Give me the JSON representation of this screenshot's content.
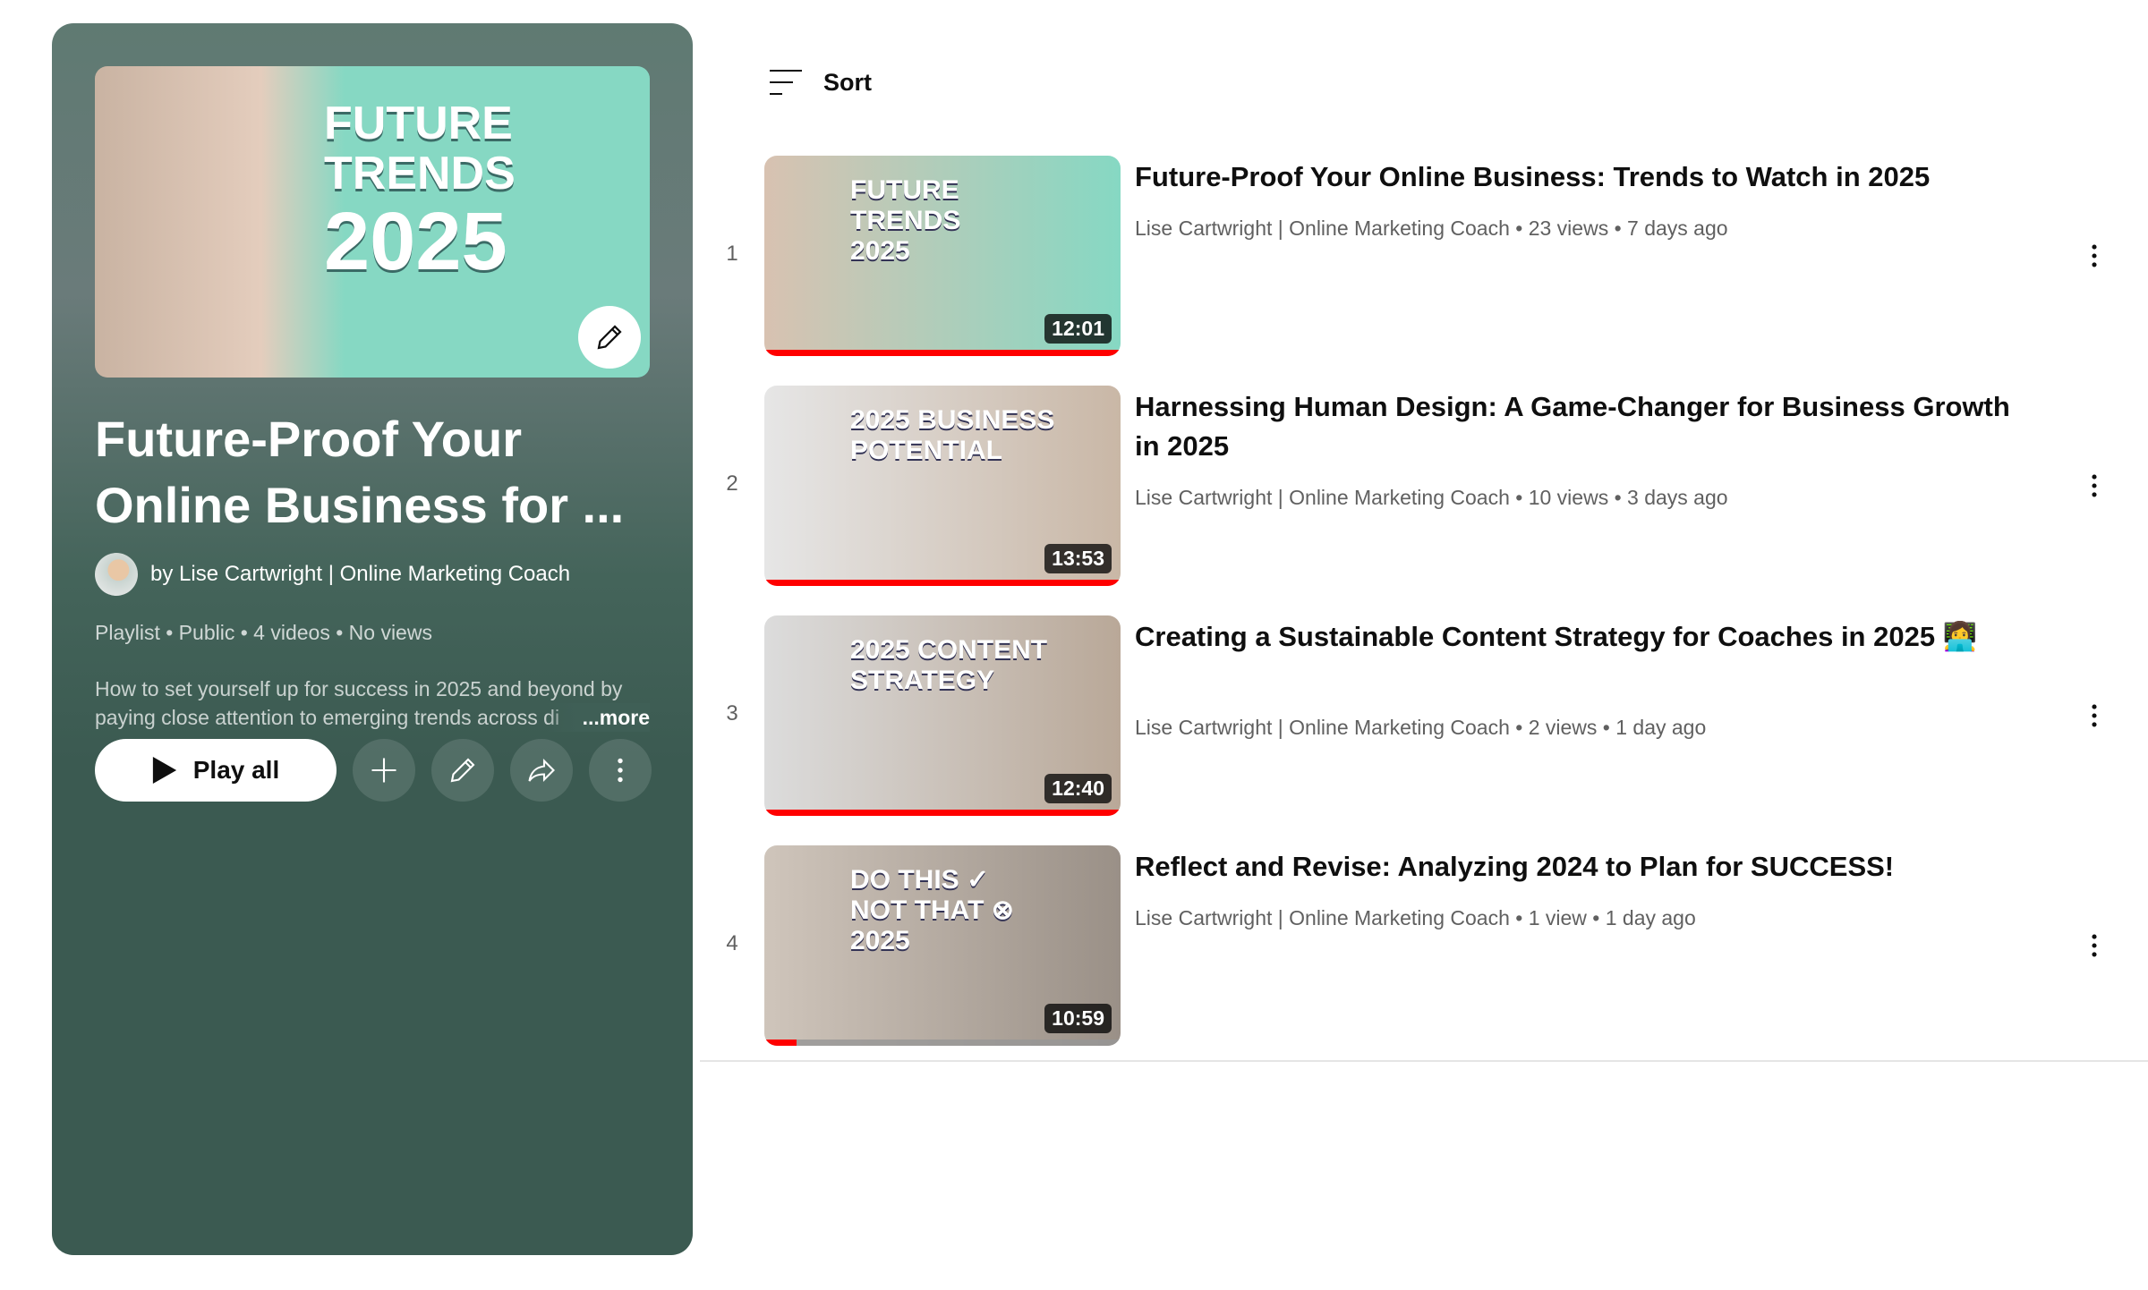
{
  "playlist": {
    "hero_text": {
      "line1": "FUTURE",
      "line2": "TRENDS",
      "year": "2025"
    },
    "title": "Future-Proof Your Online Business for ...",
    "owner": "by Lise Cartwright | Online Marketing Coach",
    "meta": "Playlist • Public • 4 videos • No views",
    "description": "How to set yourself up for success in 2025 and beyond by paying close attention to emerging trends across di",
    "more_label": "...more",
    "play_all_label": "Play all",
    "actions": [
      "add-icon",
      "pencil-icon",
      "share-icon",
      "more-vert-icon"
    ]
  },
  "sort_label": "Sort",
  "videos": [
    {
      "index": "1",
      "title": "Future-Proof Your Online Business: Trends to Watch in 2025",
      "meta": "Lise Cartwright | Online Marketing Coach • 23 views • 7 days ago",
      "duration": "12:01",
      "thumb_text": "FUTURE\nTRENDS\n2025",
      "progress_percent": 100,
      "thumb_colors": [
        "#d8c2b1",
        "#86d8c3"
      ]
    },
    {
      "index": "2",
      "title": "Harnessing Human Design: A Game-Changer for Business Growth in 2025",
      "meta": "Lise Cartwright | Online Marketing Coach • 10 views • 3 days ago",
      "duration": "13:53",
      "thumb_text": "2025 BUSINESS\nPOTENTIAL",
      "progress_percent": 100,
      "thumb_colors": [
        "#e6e6e6",
        "#c9b7a6"
      ]
    },
    {
      "index": "3",
      "title": "Creating a Sustainable Content Strategy for Coaches in 2025 👩‍💻",
      "meta": "Lise Cartwright | Online Marketing Coach • 2 views • 1 day ago",
      "duration": "12:40",
      "thumb_text": "2025 CONTENT\nSTRATEGY",
      "progress_percent": 100,
      "thumb_colors": [
        "#dcdcdc",
        "#b9a898"
      ]
    },
    {
      "index": "4",
      "title": "Reflect and Revise: Analyzing 2024 to Plan for SUCCESS!",
      "meta": "Lise Cartwright | Online Marketing Coach • 1 view • 1 day ago",
      "duration": "10:59",
      "thumb_text": "DO THIS ✓\nNOT THAT ⊗\n2025",
      "progress_percent": 9,
      "thumb_colors": [
        "#cfc5bb",
        "#9a9087"
      ]
    }
  ]
}
